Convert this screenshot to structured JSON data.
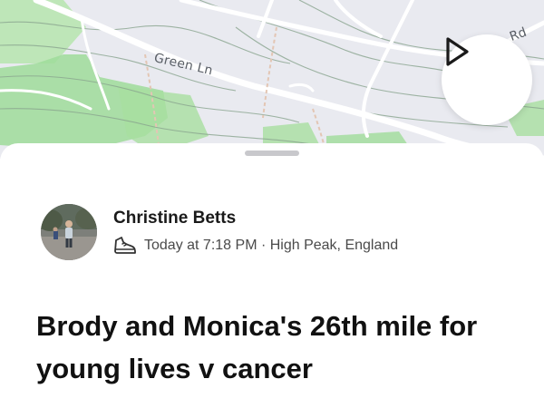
{
  "map": {
    "road_label": "Green Ln",
    "road_label_partial": "Rd",
    "colors": {
      "background": "#e9eaf0",
      "park": "#9fdc9a",
      "road": "#ffffff",
      "contour": "#8aa58f",
      "path": "#e3c6b4"
    },
    "play_icon": "play-icon"
  },
  "activity": {
    "athlete_name": "Christine Betts",
    "sport_icon": "running-shoe-icon",
    "meta": "Today at 7:18 PM · High Peak, England",
    "title": "Brody and Monica's 26th mile for young lives v cancer"
  }
}
